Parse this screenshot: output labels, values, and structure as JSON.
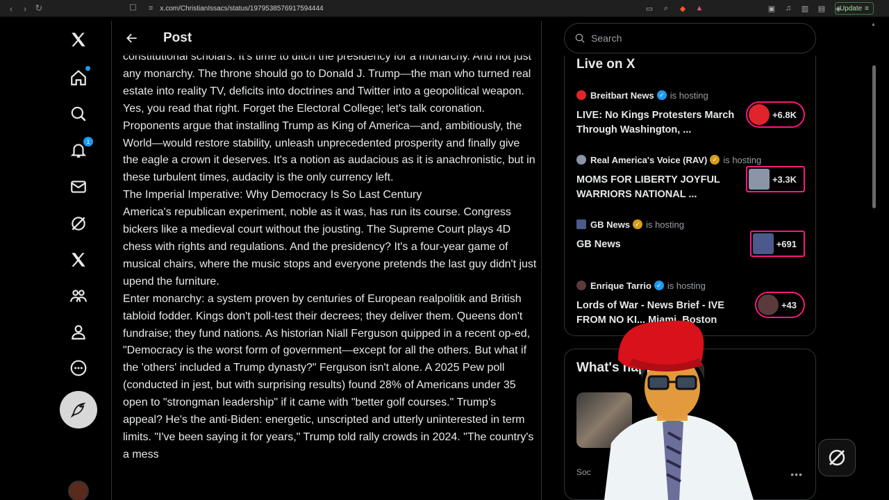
{
  "browser": {
    "url": "x.com/ChristianIssacs/status/1979538576917594444",
    "update_label": "Update"
  },
  "nav": {
    "notifications_count": "1"
  },
  "header": {
    "title": "Post"
  },
  "article": {
    "paragraphs": [
      "constitutional scholars. It's time to ditch the presidency for a monarchy. And not just any monarchy. The throne should go to Donald J. Trump—the man who turned real estate into reality TV, deficits into doctrines and Twitter into a geopolitical weapon.",
      "Yes, you read that right. Forget the Electoral College; let's talk coronation. Proponents argue that installing Trump as King of America—and, ambitiously, the World—would restore stability, unleash unprecedented prosperity and finally give the eagle a crown it deserves. It's a notion as audacious as it is anachronistic, but in these turbulent times, audacity is the only currency left.",
      "The Imperial Imperative: Why Democracy Is So Last Century",
      "America's republican experiment, noble as it was, has run its course. Congress bickers like a medieval court without the jousting. The Supreme Court plays 4D chess with rights and regulations. And the presidency? It's a four-year game of musical chairs, where the music stops and everyone pretends the last guy didn't just upend the furniture.",
      "Enter monarchy: a system proven by centuries of European realpolitik and British tabloid fodder. Kings don't poll-test their decrees; they deliver them. Queens don't fundraise; they fund nations. As historian Niall Ferguson quipped in a recent op-ed, \"Democracy is the worst form of government—except for all the others. But what if the 'others' included a Trump dynasty?\" Ferguson isn't alone. A 2025 Pew poll (conducted in jest, but with surprising results) found 28% of Americans under 35 open to \"strongman leadership\" if it came with \"better golf courses.\" Trump's appeal? He's the anti-Biden: energetic, unscripted and utterly uninterested in term limits. \"I've been saying it for years,\" Trump told rally crowds in 2024. \"The country's a mess"
    ]
  },
  "search": {
    "placeholder": "Search"
  },
  "live": {
    "heading": "Live on X",
    "hosting_label": "is hosting",
    "items": [
      {
        "host": "Breitbart News",
        "title": "LIVE: No Kings Protesters March Through Washington, ...",
        "count": "+6.8K",
        "color": "#e0242b",
        "verified": "blue"
      },
      {
        "host": "Real America's Voice (RAV)",
        "title": "MOMS FOR LIBERTY JOYFUL WARRIORS NATIONAL ...",
        "count": "+3.3K",
        "color": "#8c94a8",
        "verified": "gold"
      },
      {
        "host": "GB News",
        "title": "GB News",
        "count": "+691",
        "color": "#4a5a8a",
        "verified": "gold"
      },
      {
        "host": "Enrique Tarrio",
        "title": "Lords of War - News Brief - IVE FROM NO KI... Miami. Boston",
        "count": "+43",
        "color": "#5a3a3a",
        "verified": "blue"
      }
    ]
  },
  "trending": {
    "heading": "What's happening",
    "sub_label": "Soc"
  }
}
